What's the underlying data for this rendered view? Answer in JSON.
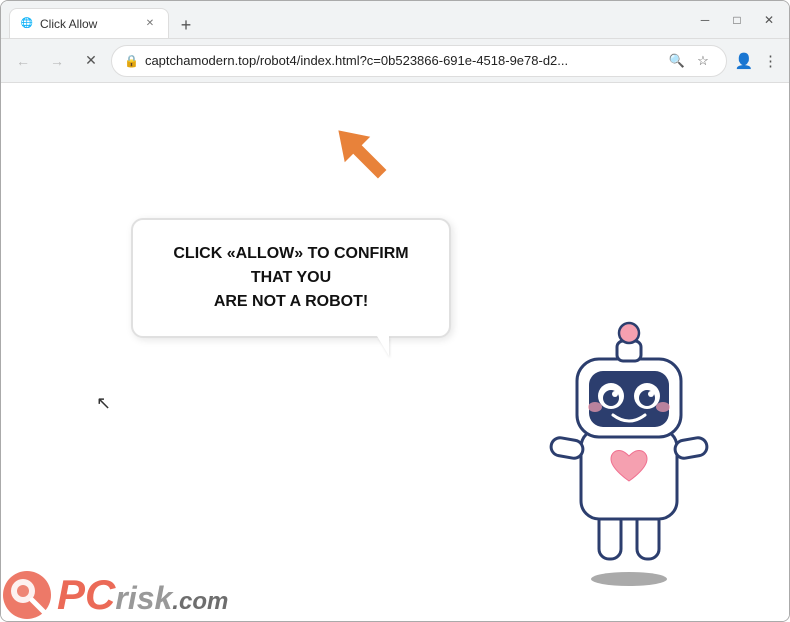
{
  "browser": {
    "tab": {
      "title": "Click Allow",
      "favicon": "🔒"
    },
    "new_tab_label": "+",
    "window_controls": {
      "minimize": "─",
      "maximize": "□",
      "close": "✕"
    },
    "address_bar": {
      "url": "captchamodern.top/robot4/index.html?c=0b523866-691e-4518-9e78-d2...",
      "lock_icon": "🔒"
    },
    "nav": {
      "back": "←",
      "forward": "→",
      "reload": "✕"
    }
  },
  "page": {
    "bubble_text_line1": "CLICK «ALLOW» TO CONFIRM THAT YOU",
    "bubble_text_line2": "ARE NOT A ROBOT!",
    "watermark": {
      "pc": "PC",
      "risk": "risk",
      "dotcom": ".com"
    }
  },
  "colors": {
    "orange_arrow": "#e8823a",
    "accent": "#e8503a"
  }
}
